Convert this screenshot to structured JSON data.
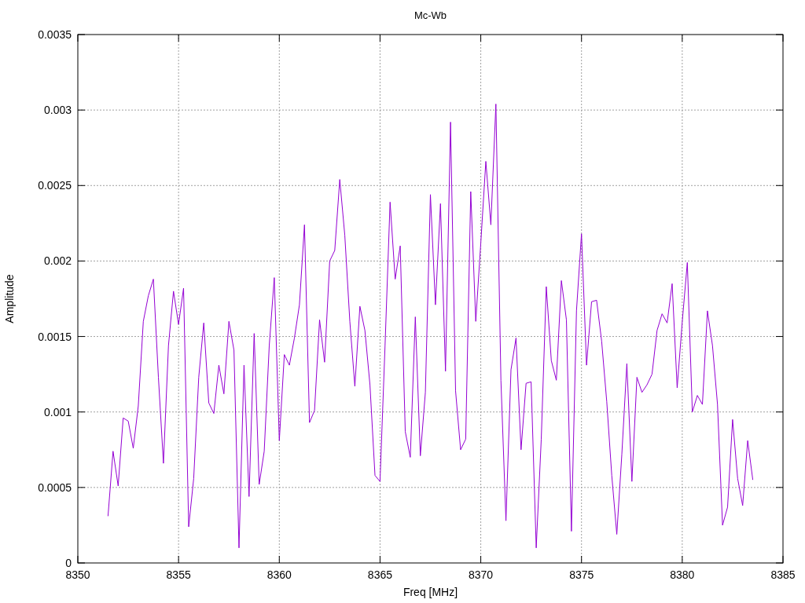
{
  "chart_data": {
    "type": "line",
    "grid": true,
    "title": "Mc-Wb",
    "xlabel": "Freq [MHz]",
    "ylabel": "Amplitude",
    "xlim": [
      8350,
      8385
    ],
    "ylim": [
      0,
      0.0035
    ],
    "xticks": [
      8350,
      8355,
      8360,
      8365,
      8370,
      8375,
      8380,
      8385
    ],
    "yticks": [
      0,
      0.0005,
      0.001,
      0.0015,
      0.002,
      0.0025,
      0.003,
      0.0035
    ],
    "x": [
      8351.5,
      8351.75,
      8352,
      8352.25,
      8352.5,
      8352.75,
      8353,
      8353.25,
      8353.5,
      8353.75,
      8354,
      8354.25,
      8354.5,
      8354.75,
      8355,
      8355.25,
      8355.5,
      8355.75,
      8356,
      8356.25,
      8356.5,
      8356.75,
      8357,
      8357.25,
      8357.5,
      8357.75,
      8358,
      8358.25,
      8358.5,
      8358.75,
      8359,
      8359.25,
      8359.5,
      8359.75,
      8360,
      8360.25,
      8360.5,
      8360.75,
      8361,
      8361.25,
      8361.5,
      8361.75,
      8362,
      8362.25,
      8362.5,
      8362.75,
      8363,
      8363.25,
      8363.5,
      8363.75,
      8364,
      8364.25,
      8364.5,
      8364.75,
      8365,
      8365.25,
      8365.5,
      8365.75,
      8366,
      8366.25,
      8366.5,
      8366.75,
      8367,
      8367.25,
      8367.5,
      8367.75,
      8368,
      8368.25,
      8368.5,
      8368.75,
      8369,
      8369.25,
      8369.5,
      8369.75,
      8370,
      8370.25,
      8370.5,
      8370.75,
      8371,
      8371.25,
      8371.5,
      8371.75,
      8372,
      8372.25,
      8372.5,
      8372.75,
      8373,
      8373.25,
      8373.5,
      8373.75,
      8374,
      8374.25,
      8374.5,
      8374.75,
      8375,
      8375.25,
      8375.5,
      8375.75,
      8376,
      8376.25,
      8376.5,
      8376.75,
      8377,
      8377.25,
      8377.5,
      8377.75,
      8378,
      8378.25,
      8378.5,
      8378.75,
      8379,
      8379.25,
      8379.5,
      8379.75,
      8380,
      8380.25,
      8380.5,
      8380.75,
      8381,
      8381.25,
      8381.5,
      8381.75,
      8382,
      8382.25,
      8382.5,
      8382.75,
      8383,
      8383.25,
      8383.5
    ],
    "series": [
      {
        "color": "#9400d3",
        "values": [
          0.00031,
          0.00074,
          0.00051,
          0.00096,
          0.00094,
          0.00076,
          0.00104,
          0.0016,
          0.00177,
          0.00188,
          0.00123,
          0.00066,
          0.00144,
          0.0018,
          0.00158,
          0.00182,
          0.00024,
          0.00056,
          0.00123,
          0.00159,
          0.00106,
          0.00099,
          0.00131,
          0.00112,
          0.0016,
          0.00141,
          0.0001,
          0.00131,
          0.00044,
          0.00152,
          0.00052,
          0.00074,
          0.00144,
          0.00189,
          0.00081,
          0.00138,
          0.00131,
          0.00149,
          0.00171,
          0.00224,
          0.00093,
          0.00101,
          0.00161,
          0.00133,
          0.002,
          0.00207,
          0.00254,
          0.00217,
          0.0016,
          0.00117,
          0.0017,
          0.00154,
          0.00118,
          0.00058,
          0.00054,
          0.00144,
          0.00239,
          0.00188,
          0.0021,
          0.00087,
          0.0007,
          0.00163,
          0.00071,
          0.00113,
          0.00244,
          0.00171,
          0.00238,
          0.00127,
          0.00292,
          0.00114,
          0.00075,
          0.00082,
          0.00246,
          0.0016,
          0.00212,
          0.00266,
          0.00224,
          0.00304,
          0.00121,
          0.00028,
          0.00128,
          0.00149,
          0.00075,
          0.00119,
          0.0012,
          0.0001,
          0.00082,
          0.00183,
          0.00134,
          0.00121,
          0.00187,
          0.00161,
          0.00021,
          0.00167,
          0.00218,
          0.00131,
          0.00173,
          0.00174,
          0.00147,
          0.00107,
          0.00058,
          0.00019,
          0.00072,
          0.00132,
          0.00054,
          0.00123,
          0.00113,
          0.00118,
          0.00125,
          0.00154,
          0.00165,
          0.00159,
          0.00185,
          0.00116,
          0.0016,
          0.00199,
          0.001,
          0.00111,
          0.00105,
          0.00167,
          0.00144,
          0.00105,
          0.00025,
          0.00037,
          0.00095,
          0.00056,
          0.00038,
          0.00081,
          0.00055
        ]
      }
    ]
  }
}
